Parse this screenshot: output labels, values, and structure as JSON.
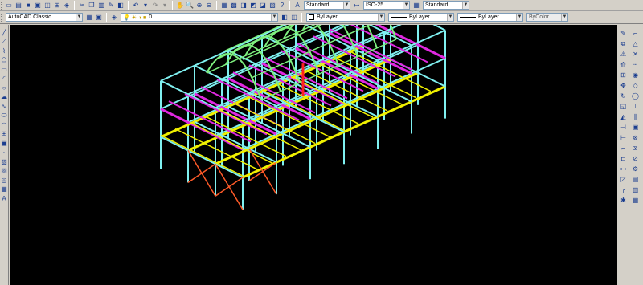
{
  "toolbar_top": {
    "text_style": "Standard",
    "dim_style": "ISO-25",
    "table_style": "Standard"
  },
  "toolbar_props": {
    "workspace": "AutoCAD Classic",
    "layer": "0",
    "color": "ByLayer",
    "linetype": "ByLayer",
    "lineweight": "ByLayer",
    "plotstyle": "ByColor"
  },
  "colors": {
    "canvas": "#000000",
    "columns": "#7ff0f0",
    "beams_magenta": "#e028e0",
    "beams_yellow": "#f0f000",
    "arches_green": "#7ff07f",
    "bracing_orange": "#ff5a28",
    "bracing_red": "#ff2020"
  },
  "icons": {
    "left": [
      "line-icon",
      "construction-line-icon",
      "polyline-icon",
      "polygon-icon",
      "rectangle-icon",
      "arc-icon",
      "circle-icon",
      "revcloud-icon",
      "spline-icon",
      "ellipse-icon",
      "ellipse-arc-icon",
      "insert-block-icon",
      "make-block-icon",
      "point-icon",
      "hatch-icon",
      "gradient-icon",
      "region-icon",
      "table-icon",
      "mtext-icon"
    ],
    "right_a": [
      "erase-icon",
      "copy-icon",
      "mirror-icon",
      "offset-icon",
      "array-icon",
      "move-icon",
      "rotate-icon",
      "scale-icon",
      "stretch-icon",
      "trim-icon",
      "extend-icon",
      "break-at-point-icon",
      "break-icon",
      "join-icon",
      "chamfer-icon",
      "fillet-icon",
      "explode-icon"
    ],
    "right_b": [
      "snap-endpoint-icon",
      "snap-midpoint-icon",
      "snap-intersection-icon",
      "snap-extension-icon",
      "snap-center-icon",
      "snap-quadrant-icon",
      "snap-tangent-icon",
      "snap-perpendicular-icon",
      "snap-parallel-icon",
      "snap-insert-icon",
      "snap-node-icon",
      "snap-nearest-icon",
      "snap-none-icon",
      "osnap-settings-icon",
      "draworder-front-icon",
      "draworder-back-icon",
      "draworder-above-icon"
    ]
  }
}
